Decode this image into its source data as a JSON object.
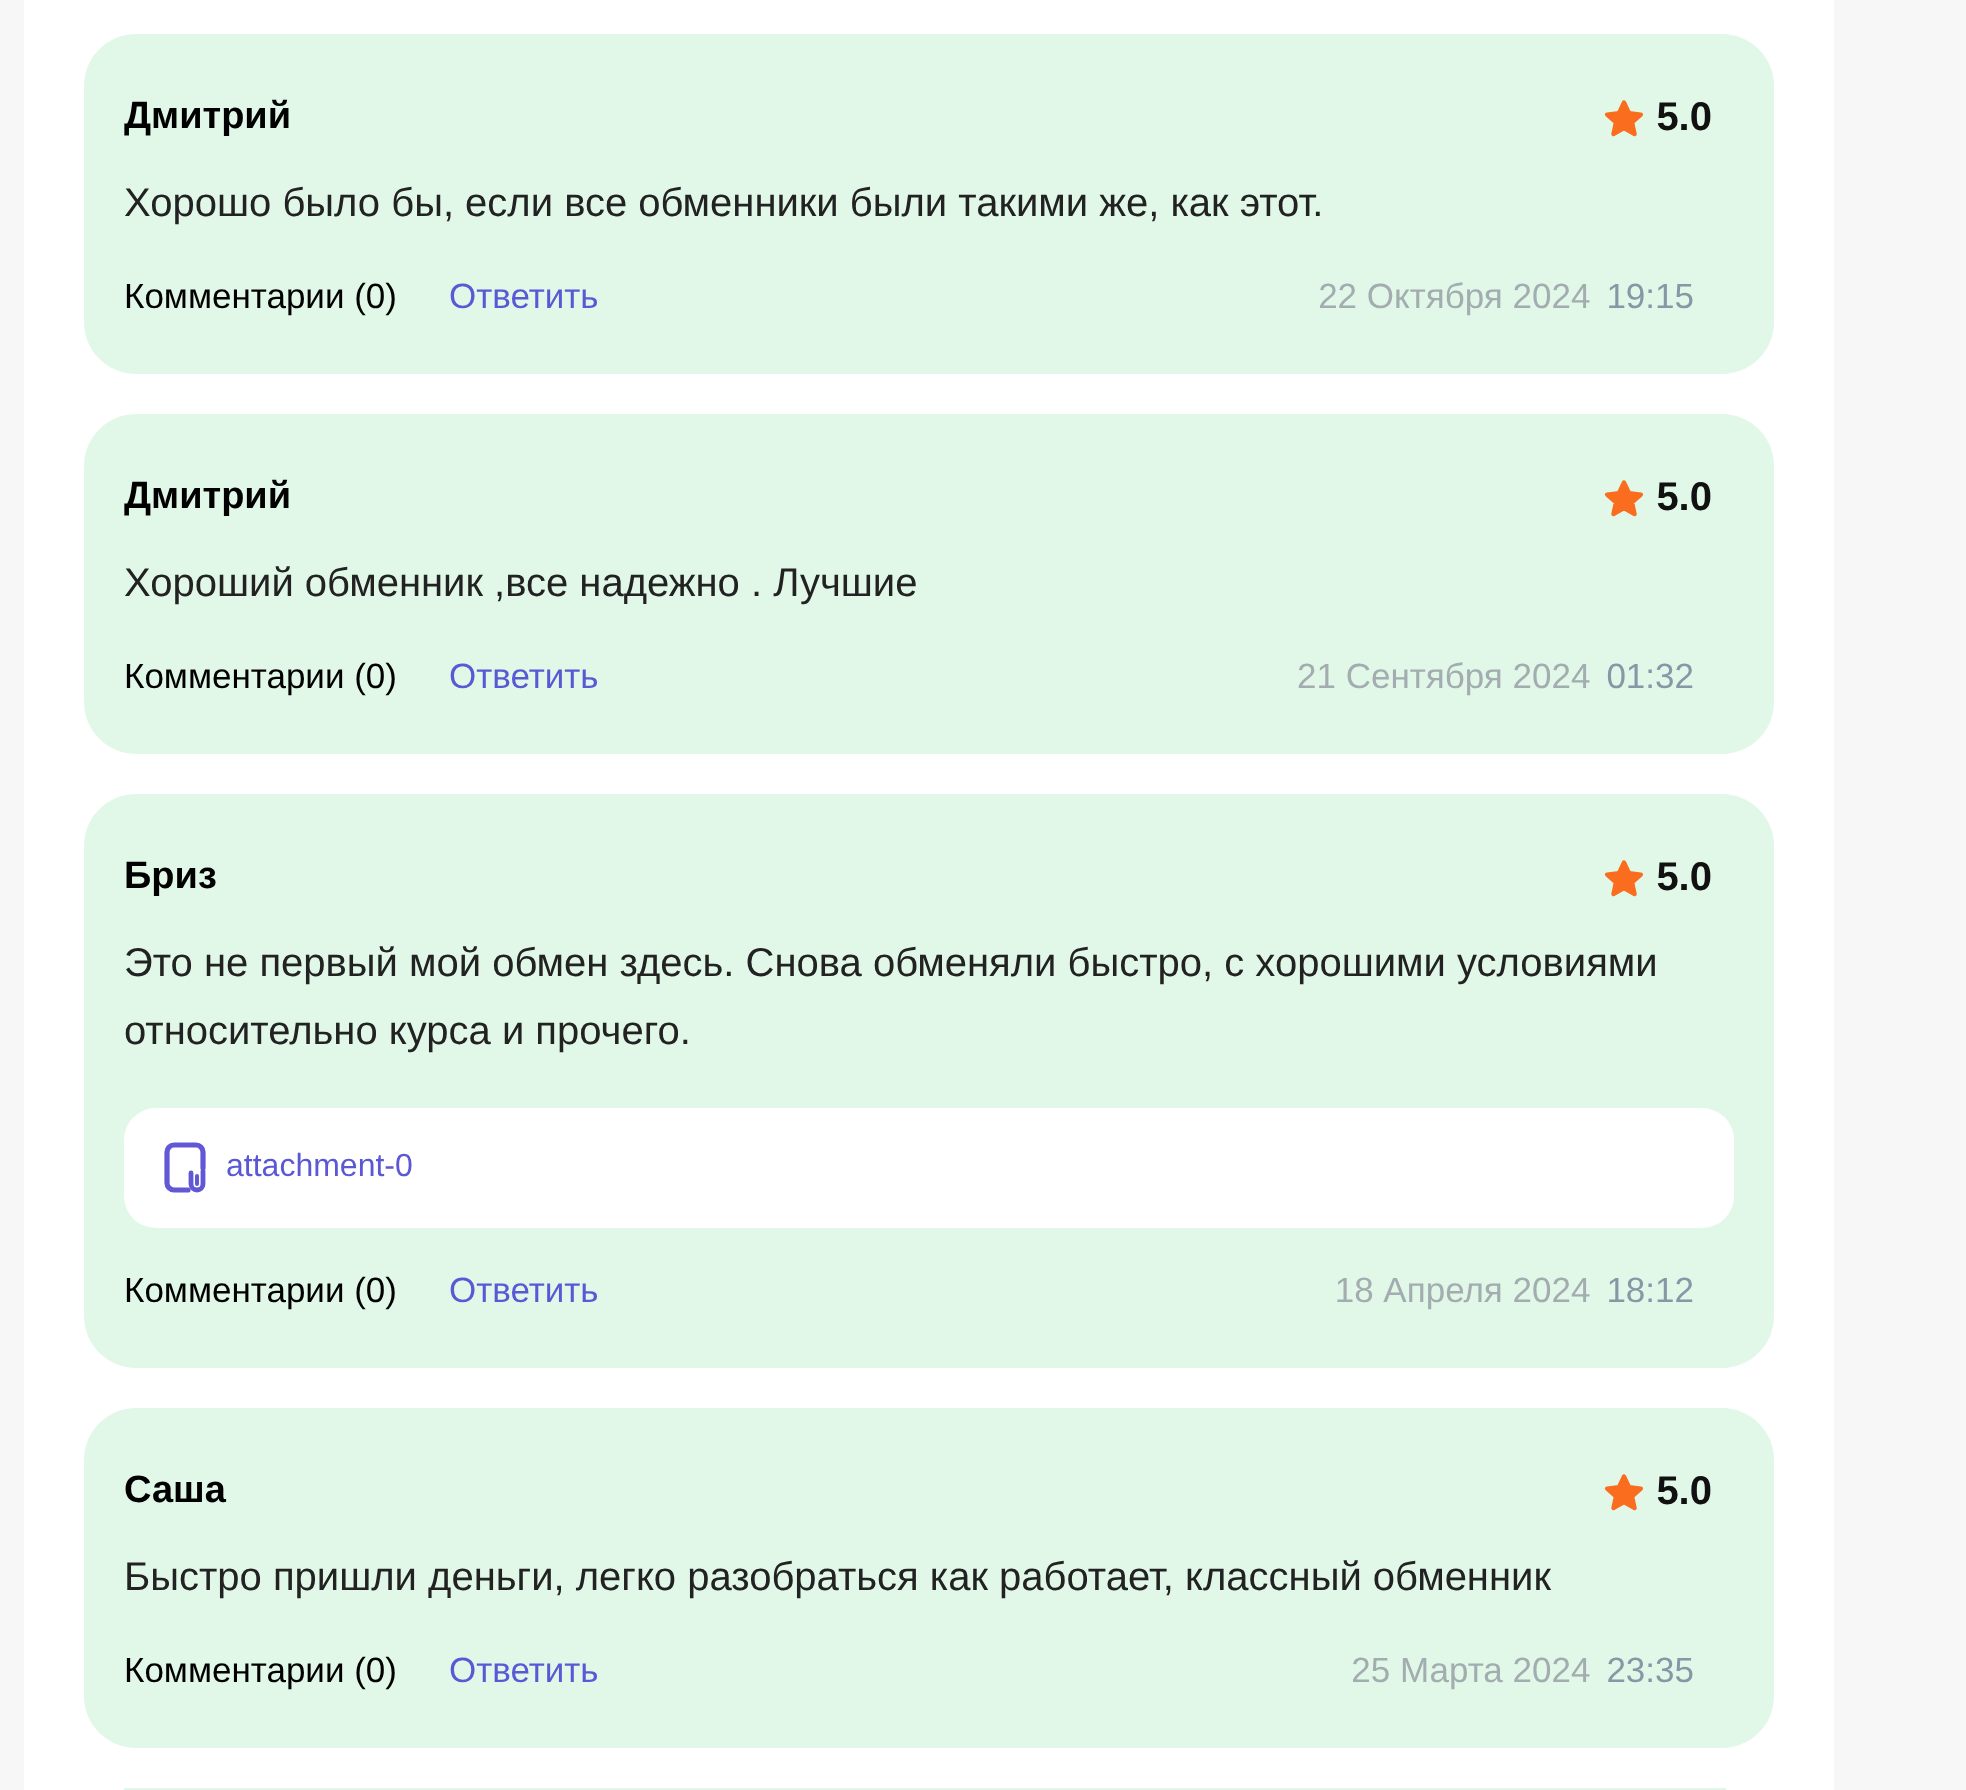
{
  "reviews": [
    {
      "author": "Дмитрий",
      "rating": "5.0",
      "text": "Хорошо было бы, если все обменники были такими же, как этот.",
      "comments": "Комментарии (0)",
      "reply": "Ответить",
      "date": "22 Октября 2024",
      "time": "19:15"
    },
    {
      "author": "Дмитрий",
      "rating": "5.0",
      "text": "Хороший обменник ,все надежно . Лучшие",
      "comments": "Комментарии (0)",
      "reply": "Ответить",
      "date": "21 Сентября 2024",
      "time": "01:32"
    },
    {
      "author": "Бриз",
      "rating": "5.0",
      "text": "Это не первый мой обмен здесь. Снова обменяли быстро, с хорошими условиями относительно курса и прочего.",
      "attachments": [
        "attachment-0"
      ],
      "comments": "Комментарии (0)",
      "reply": "Ответить",
      "date": "18 Апреля 2024",
      "time": "18:12"
    },
    {
      "author": "Саша",
      "rating": "5.0",
      "text": "Быстро пришли деньги, легко разобраться как работает, классный обменник",
      "comments": "Комментарии (0)",
      "reply": "Ответить",
      "date": "25 Марта 2024",
      "time": "23:35"
    }
  ]
}
